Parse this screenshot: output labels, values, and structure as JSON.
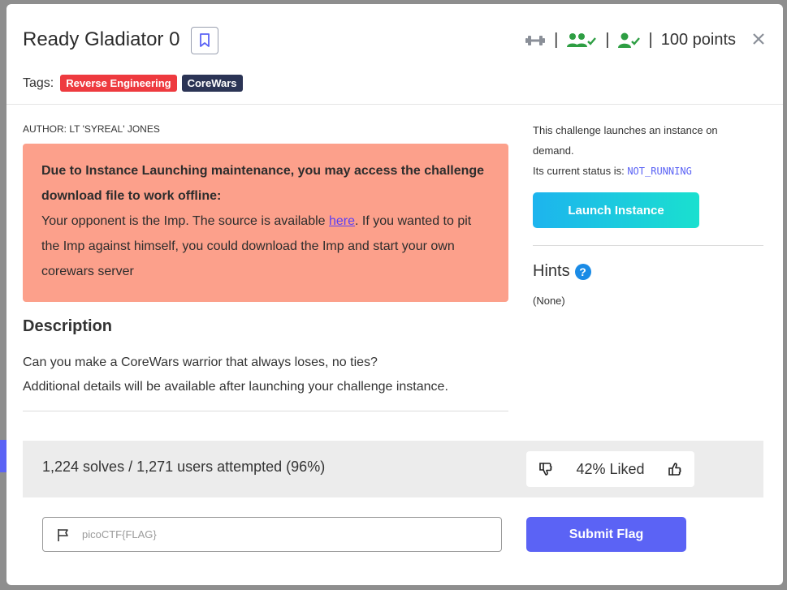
{
  "challenge": {
    "title": "Ready Gladiator 0",
    "points": "100 points",
    "tags_label": "Tags:",
    "tags": [
      {
        "label": "Reverse Engineering",
        "color": "#ee3a3f"
      },
      {
        "label": "CoreWars",
        "color": "#2b3455"
      }
    ],
    "author": "AUTHOR: LT 'SYREAL' JONES"
  },
  "header_icons": {
    "difficulty": "dumbbell-icon",
    "solved_team": "users-check-icon",
    "solved_user": "user-check-icon",
    "difficulty_color": "#8a8f98",
    "check_color": "#2e9e43"
  },
  "alert": {
    "heading": "Due to Instance Launching maintenance, you may access the challenge download file to work offline:",
    "text_before_link": "Your opponent is the Imp. The source is available ",
    "link_text": "here",
    "text_after_link": ". If you wanted to pit the Imp against himself, you could download the Imp and start your own corewars server"
  },
  "description": {
    "title": "Description",
    "line1": "Can you make a CoreWars warrior that always loses, no ties?",
    "line2": "Additional details will be available after launching your challenge instance."
  },
  "instance": {
    "info": "This challenge launches an instance on demand.",
    "status_label": "Its current status is: ",
    "status": "NOT_RUNNING",
    "launch_label": "Launch Instance"
  },
  "hints": {
    "title": "Hints",
    "icon": "question-circle-icon",
    "value": "(None)"
  },
  "stats": {
    "solves_text": "1,224 solves / 1,271 users attempted (96%)",
    "liked_text": "42% Liked"
  },
  "flag": {
    "placeholder": "picoCTF{FLAG}",
    "submit_label": "Submit Flag"
  }
}
